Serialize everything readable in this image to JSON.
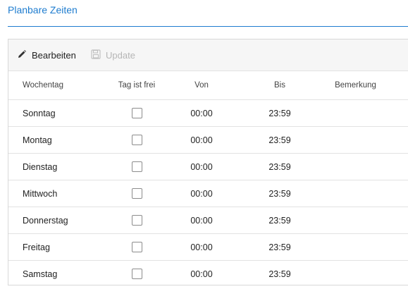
{
  "page": {
    "title": "Planbare Zeiten"
  },
  "toolbar": {
    "edit_label": "Bearbeiten",
    "edit_icon": "pencil-icon",
    "update_label": "Update",
    "update_icon": "save-icon"
  },
  "table": {
    "columns": [
      "Wochentag",
      "Tag ist frei",
      "Von",
      "Bis",
      "Bemerkung"
    ],
    "rows": [
      {
        "day": "Sonntag",
        "free": false,
        "von": "00:00",
        "bis": "23:59",
        "note": ""
      },
      {
        "day": "Montag",
        "free": false,
        "von": "00:00",
        "bis": "23:59",
        "note": ""
      },
      {
        "day": "Dienstag",
        "free": false,
        "von": "00:00",
        "bis": "23:59",
        "note": ""
      },
      {
        "day": "Mittwoch",
        "free": false,
        "von": "00:00",
        "bis": "23:59",
        "note": ""
      },
      {
        "day": "Donnerstag",
        "free": false,
        "von": "00:00",
        "bis": "23:59",
        "note": ""
      },
      {
        "day": "Freitag",
        "free": false,
        "von": "00:00",
        "bis": "23:59",
        "note": ""
      },
      {
        "day": "Samstag",
        "free": false,
        "von": "00:00",
        "bis": "23:59",
        "note": ""
      }
    ]
  },
  "colors": {
    "accent": "#1e7ccf",
    "disabled_text": "#b6b6b6",
    "toolbar_bg": "#f6f6f6",
    "border": "#e2e2e2"
  }
}
